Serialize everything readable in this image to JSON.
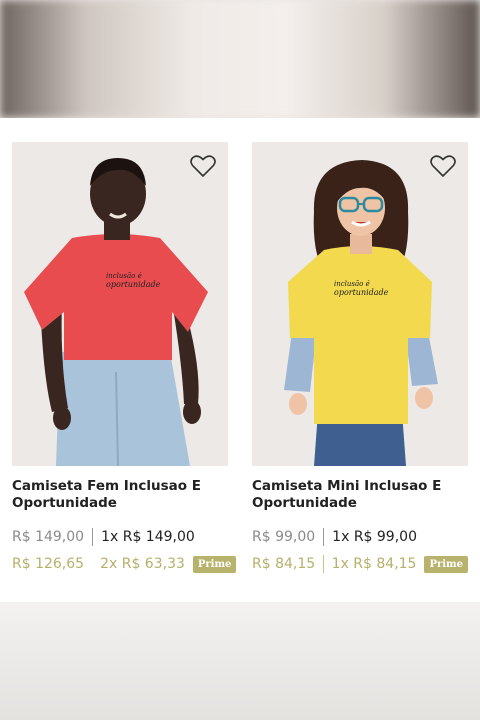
{
  "products": [
    {
      "title": "Camiseta Fem Inclusao E Oportunidade",
      "price": "R$ 149,00",
      "installment": "1x R$ 149,00",
      "prime_price": "R$ 126,65",
      "prime_installment": "2x R$ 63,33",
      "badge": "Prime",
      "shirt_color": "#e84c4f",
      "shirt_text": "inclusão é oportunidade",
      "favorite_icon": "heart-outline-icon"
    },
    {
      "title": "Camiseta Mini Inclusao E Oportunidade",
      "price": "R$ 99,00",
      "installment": "1x R$ 99,00",
      "prime_price": "R$ 84,15",
      "prime_installment": "1x R$ 84,15",
      "badge": "Prime",
      "shirt_color": "#f2d94e",
      "shirt_text": "inclusão é oportunidade",
      "favorite_icon": "heart-outline-icon"
    }
  ],
  "colors": {
    "prime_accent": "#b8b36c"
  }
}
